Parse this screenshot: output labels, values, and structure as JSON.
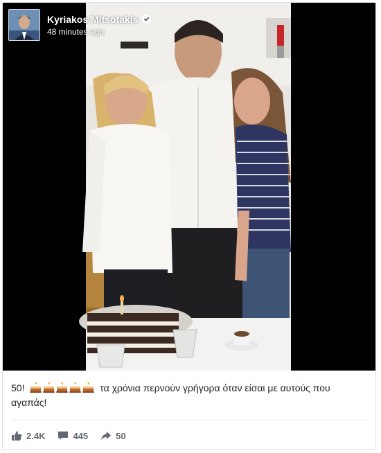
{
  "post": {
    "author": "Kyriakos Mitsotakis",
    "timestamp": "48 minutes ago",
    "verified": true,
    "caption_prefix": "50!",
    "caption_emoji": [
      "cake-icon",
      "cake-icon",
      "cake-icon",
      "cake-icon",
      "cake-icon"
    ],
    "caption_text": "τα χρόνια περνούν γρήγορα όταν είσαι με αυτούς που αγαπάς!"
  },
  "engagement": {
    "likes": "2.4K",
    "comments": "445",
    "shares": "50"
  },
  "colors": {
    "accent": "#4267b2",
    "text": "#1d2129",
    "muted": "#616770"
  }
}
